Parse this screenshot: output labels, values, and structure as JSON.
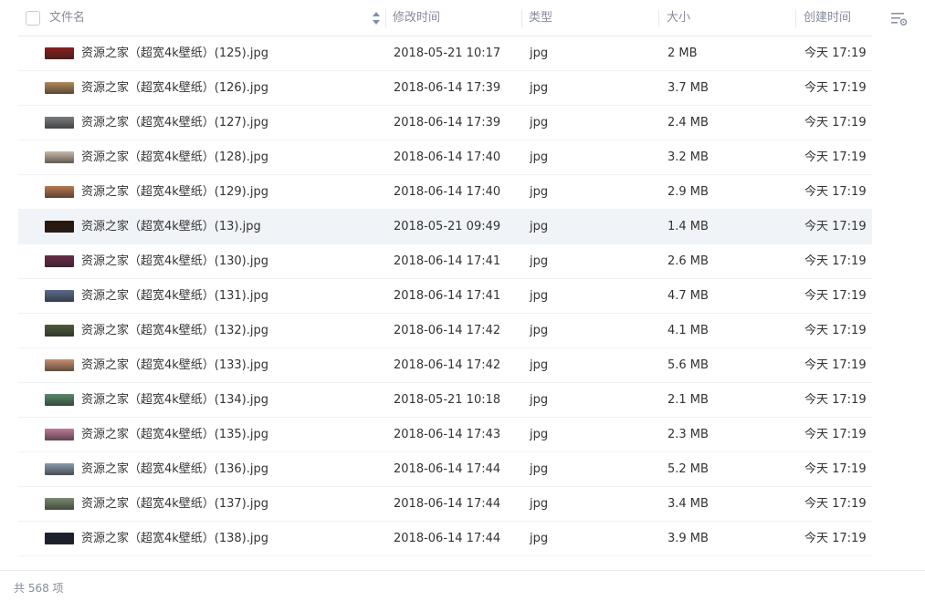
{
  "columns": {
    "name": "文件名",
    "modified": "修改时间",
    "type": "类型",
    "size": "大小",
    "created": "创建时间"
  },
  "files": [
    {
      "name": "资源之家（超宽4k壁纸）(125).jpg",
      "modified": "2018-05-21 10:17",
      "type": "jpg",
      "size": "2 MB",
      "created": "今天 17:19",
      "thumb": "#8a1c1c"
    },
    {
      "name": "资源之家（超宽4k壁纸）(126).jpg",
      "modified": "2018-06-14 17:39",
      "type": "jpg",
      "size": "3.7 MB",
      "created": "今天 17:19",
      "thumb": "#b08a5a"
    },
    {
      "name": "资源之家（超宽4k壁纸）(127).jpg",
      "modified": "2018-06-14 17:39",
      "type": "jpg",
      "size": "2.4 MB",
      "created": "今天 17:19",
      "thumb": "#7a7d80"
    },
    {
      "name": "资源之家（超宽4k壁纸）(128).jpg",
      "modified": "2018-06-14 17:40",
      "type": "jpg",
      "size": "3.2 MB",
      "created": "今天 17:19",
      "thumb": "#c9b7a8"
    },
    {
      "name": "资源之家（超宽4k壁纸）(129).jpg",
      "modified": "2018-06-14 17:40",
      "type": "jpg",
      "size": "2.9 MB",
      "created": "今天 17:19",
      "thumb": "#b87850"
    },
    {
      "name": "资源之家（超宽4k壁纸）(13).jpg",
      "modified": "2018-05-21 09:49",
      "type": "jpg",
      "size": "1.4 MB",
      "created": "今天 17:19",
      "thumb": "#2a1508"
    },
    {
      "name": "资源之家（超宽4k壁纸）(130).jpg",
      "modified": "2018-06-14 17:41",
      "type": "jpg",
      "size": "2.6 MB",
      "created": "今天 17:19",
      "thumb": "#6a2a4a"
    },
    {
      "name": "资源之家（超宽4k壁纸）(131).jpg",
      "modified": "2018-06-14 17:41",
      "type": "jpg",
      "size": "4.7 MB",
      "created": "今天 17:19",
      "thumb": "#5a6a8a"
    },
    {
      "name": "资源之家（超宽4k壁纸）(132).jpg",
      "modified": "2018-06-14 17:42",
      "type": "jpg",
      "size": "4.1 MB",
      "created": "今天 17:19",
      "thumb": "#4a5a3a"
    },
    {
      "name": "资源之家（超宽4k壁纸）(133).jpg",
      "modified": "2018-06-14 17:42",
      "type": "jpg",
      "size": "5.6 MB",
      "created": "今天 17:19",
      "thumb": "#c89070"
    },
    {
      "name": "资源之家（超宽4k壁纸）(134).jpg",
      "modified": "2018-05-21 10:18",
      "type": "jpg",
      "size": "2.1 MB",
      "created": "今天 17:19",
      "thumb": "#5a8a6a"
    },
    {
      "name": "资源之家（超宽4k壁纸）(135).jpg",
      "modified": "2018-06-14 17:43",
      "type": "jpg",
      "size": "2.3 MB",
      "created": "今天 17:19",
      "thumb": "#c07a9a"
    },
    {
      "name": "资源之家（超宽4k壁纸）(136).jpg",
      "modified": "2018-06-14 17:44",
      "type": "jpg",
      "size": "5.2 MB",
      "created": "今天 17:19",
      "thumb": "#8a9aaa"
    },
    {
      "name": "资源之家（超宽4k壁纸）(137).jpg",
      "modified": "2018-06-14 17:44",
      "type": "jpg",
      "size": "3.4 MB",
      "created": "今天 17:19",
      "thumb": "#7a8a70"
    },
    {
      "name": "资源之家（超宽4k壁纸）(138).jpg",
      "modified": "2018-06-14 17:44",
      "type": "jpg",
      "size": "3.9 MB",
      "created": "今天 17:19",
      "thumb": "#1a2030"
    }
  ],
  "footer": {
    "count_label": "共 568 项"
  },
  "icons": {
    "sort": "sort-arrows-icon",
    "filter": "filter-settings-icon"
  }
}
